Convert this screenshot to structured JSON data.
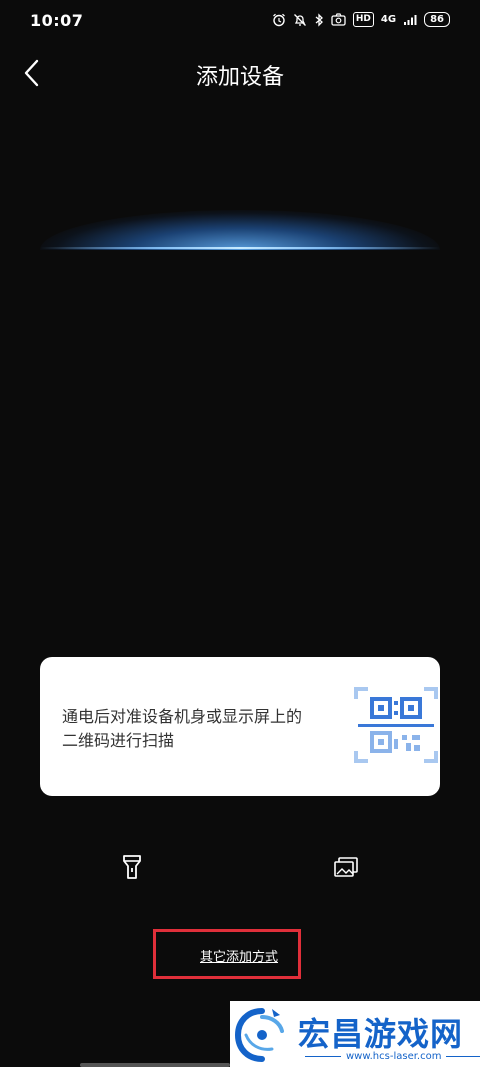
{
  "status_bar": {
    "time": "10:07",
    "hd_badge": "HD",
    "network": "4G",
    "battery": "86"
  },
  "header": {
    "title": "添加设备"
  },
  "hint_card": {
    "text": "通电后对准设备机身或显示屏上的二维码进行扫描"
  },
  "tools": {
    "flashlight_icon": "flashlight-icon",
    "gallery_icon": "gallery-icon"
  },
  "other_methods": {
    "label": "其它添加方式",
    "highlight_color": "#e02f3a"
  },
  "watermark": {
    "title": "宏昌游戏网",
    "url": "www.hcs-laser.com",
    "color": "#1463c9"
  },
  "colors": {
    "background": "#0b0b0b",
    "scan_glow": "#6ab4ff",
    "qr_accent": "#3a78d8"
  }
}
